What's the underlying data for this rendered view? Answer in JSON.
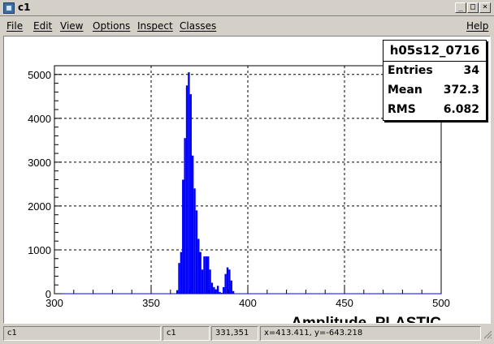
{
  "window": {
    "title": "c1",
    "min_glyph": "_",
    "max_glyph": "□",
    "close_glyph": "×"
  },
  "menu": {
    "items": [
      "File",
      "Edit",
      "View",
      "Options",
      "Inspect",
      "Classes"
    ],
    "help": "Help"
  },
  "stats": {
    "title": "h05s12_0716",
    "entries_label": "Entries",
    "entries_value": "34",
    "mean_label": "Mean",
    "mean_value": "372.3",
    "rms_label": "RMS",
    "rms_value": "6.082"
  },
  "chart_data": {
    "type": "bar",
    "title": "",
    "xlabel": "Amplitude_PLASTIC",
    "ylabel": "",
    "xlim": [
      300,
      500
    ],
    "ylim": [
      0,
      5200
    ],
    "xticks": [
      300,
      350,
      400,
      450,
      500
    ],
    "yticks": [
      0,
      1000,
      2000,
      3000,
      4000,
      5000
    ],
    "grid": true,
    "color": "#0000ff",
    "bin_width": 1,
    "bins_x": [
      363,
      364,
      365,
      366,
      367,
      368,
      369,
      370,
      371,
      372,
      373,
      374,
      375,
      376,
      377,
      378,
      379,
      380,
      381,
      382,
      383,
      384,
      385,
      386,
      387,
      388,
      389,
      390,
      391,
      392
    ],
    "values": [
      80,
      700,
      950,
      2600,
      3550,
      4750,
      5050,
      4550,
      3150,
      2400,
      1900,
      1250,
      950,
      550,
      850,
      850,
      850,
      550,
      250,
      150,
      100,
      180,
      40,
      20,
      150,
      450,
      600,
      550,
      300,
      60
    ]
  },
  "status": {
    "f1": "c1",
    "f2": "c1",
    "f3": "331,351",
    "f4": "x=413.411, y=-643.218"
  }
}
